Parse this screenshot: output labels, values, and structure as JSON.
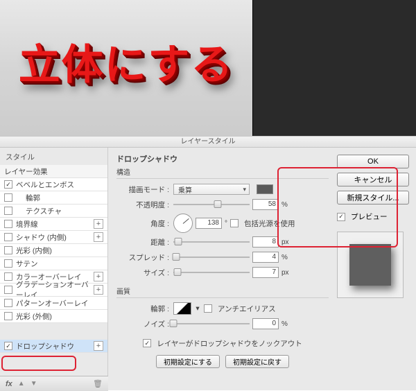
{
  "canvas": {
    "red_text": "立体にする"
  },
  "dialog": {
    "title": "レイヤースタイル"
  },
  "styles": {
    "header": "スタイル",
    "layer_effect": "レイヤー効果",
    "bevel": "ベベルとエンボス",
    "contour": "輪郭",
    "texture": "テクスチャ",
    "stroke": "境界線",
    "inner_shadow": "シャドウ (内側)",
    "inner_glow": "光彩 (内側)",
    "satin": "サテン",
    "color_overlay": "カラーオーバーレイ",
    "gradient_overlay": "グラデーションオーバーレイ",
    "pattern_overlay": "パターンオーバーレイ",
    "outer_glow": "光彩 (外側)",
    "drop_shadow": "ドロップシャドウ"
  },
  "drop": {
    "section": "ドロップシャドウ",
    "structure": "構造",
    "blend_label": "描画モード :",
    "blend_value": "乗算",
    "opacity_label": "不透明度 :",
    "opacity_value": "58",
    "opacity_unit": "%",
    "angle_label": "角度 :",
    "angle_value": "138",
    "angle_unit": "°",
    "global_light": "包括光源を使用",
    "distance_label": "距離 :",
    "distance_value": "8",
    "spread_label": "スプレッド :",
    "spread_value": "4",
    "size_label": "サイズ :",
    "size_value": "7",
    "px": "px",
    "pct": "%",
    "quality": "画質",
    "contour_label": "輪郭 :",
    "antialias": "アンチエイリアス",
    "noise_label": "ノイズ :",
    "noise_value": "0",
    "knockout": "レイヤーがドロップシャドウをノックアウト",
    "make_default": "初期設定にする",
    "reset_default": "初期設定に戻す"
  },
  "right": {
    "ok": "OK",
    "cancel": "キャンセル",
    "new_style": "新規スタイル...",
    "preview": "プレビュー"
  },
  "footer": {
    "fx": "fx"
  }
}
